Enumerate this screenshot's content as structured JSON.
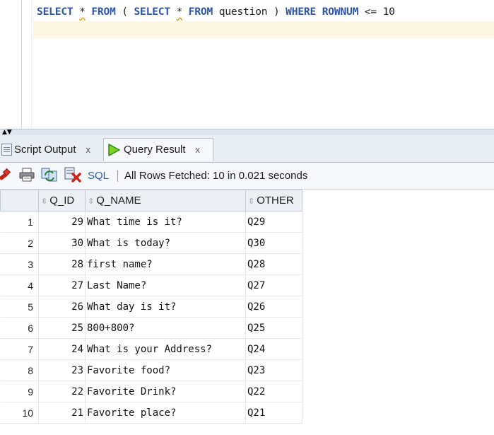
{
  "editor": {
    "sql_tokens": [
      {
        "t": "SELECT",
        "k": "kw"
      },
      {
        "t": " "
      },
      {
        "t": "*",
        "k": "star"
      },
      {
        "t": " "
      },
      {
        "t": "FROM",
        "k": "kw"
      },
      {
        "t": " ( "
      },
      {
        "t": "SELECT",
        "k": "kw"
      },
      {
        "t": " "
      },
      {
        "t": "*",
        "k": "star"
      },
      {
        "t": " "
      },
      {
        "t": "FROM",
        "k": "kw"
      },
      {
        "t": " question ) "
      },
      {
        "t": "WHERE",
        "k": "kw"
      },
      {
        "t": " "
      },
      {
        "t": "ROWNUM",
        "k": "kw"
      },
      {
        "t": " <= "
      },
      {
        "t": "10",
        "k": "num"
      }
    ]
  },
  "tabs": {
    "script_output": {
      "label": "Script Output",
      "close": "x",
      "icon": "script-icon"
    },
    "query_result": {
      "label": "Query Result",
      "close": "x",
      "icon": "play-icon"
    }
  },
  "toolbar": {
    "sql_label": "SQL",
    "status": "All Rows Fetched: 10 in 0.021 seconds",
    "icons": [
      "pin-icon",
      "print-icon",
      "refresh-icon",
      "export-icon"
    ]
  },
  "grid": {
    "columns": [
      "Q_ID",
      "Q_NAME",
      "OTHER"
    ],
    "rows": [
      {
        "n": "1",
        "id": "29",
        "name": "What time is it?",
        "other": "Q29"
      },
      {
        "n": "2",
        "id": "30",
        "name": "What is today?",
        "other": "Q30"
      },
      {
        "n": "3",
        "id": "28",
        "name": "first name?",
        "other": "Q28"
      },
      {
        "n": "4",
        "id": "27",
        "name": "Last Name?",
        "other": "Q27"
      },
      {
        "n": "5",
        "id": "26",
        "name": "What day is it?",
        "other": "Q26"
      },
      {
        "n": "6",
        "id": "25",
        "name": "800+800?",
        "other": "Q25"
      },
      {
        "n": "7",
        "id": "24",
        "name": "What is your Address?",
        "other": "Q24"
      },
      {
        "n": "8",
        "id": "23",
        "name": "Favorite food?",
        "other": "Q23"
      },
      {
        "n": "9",
        "id": "22",
        "name": "Favorite Drink?",
        "other": "Q22"
      },
      {
        "n": "10",
        "id": "21",
        "name": "Favorite place?",
        "other": "Q21"
      }
    ]
  }
}
